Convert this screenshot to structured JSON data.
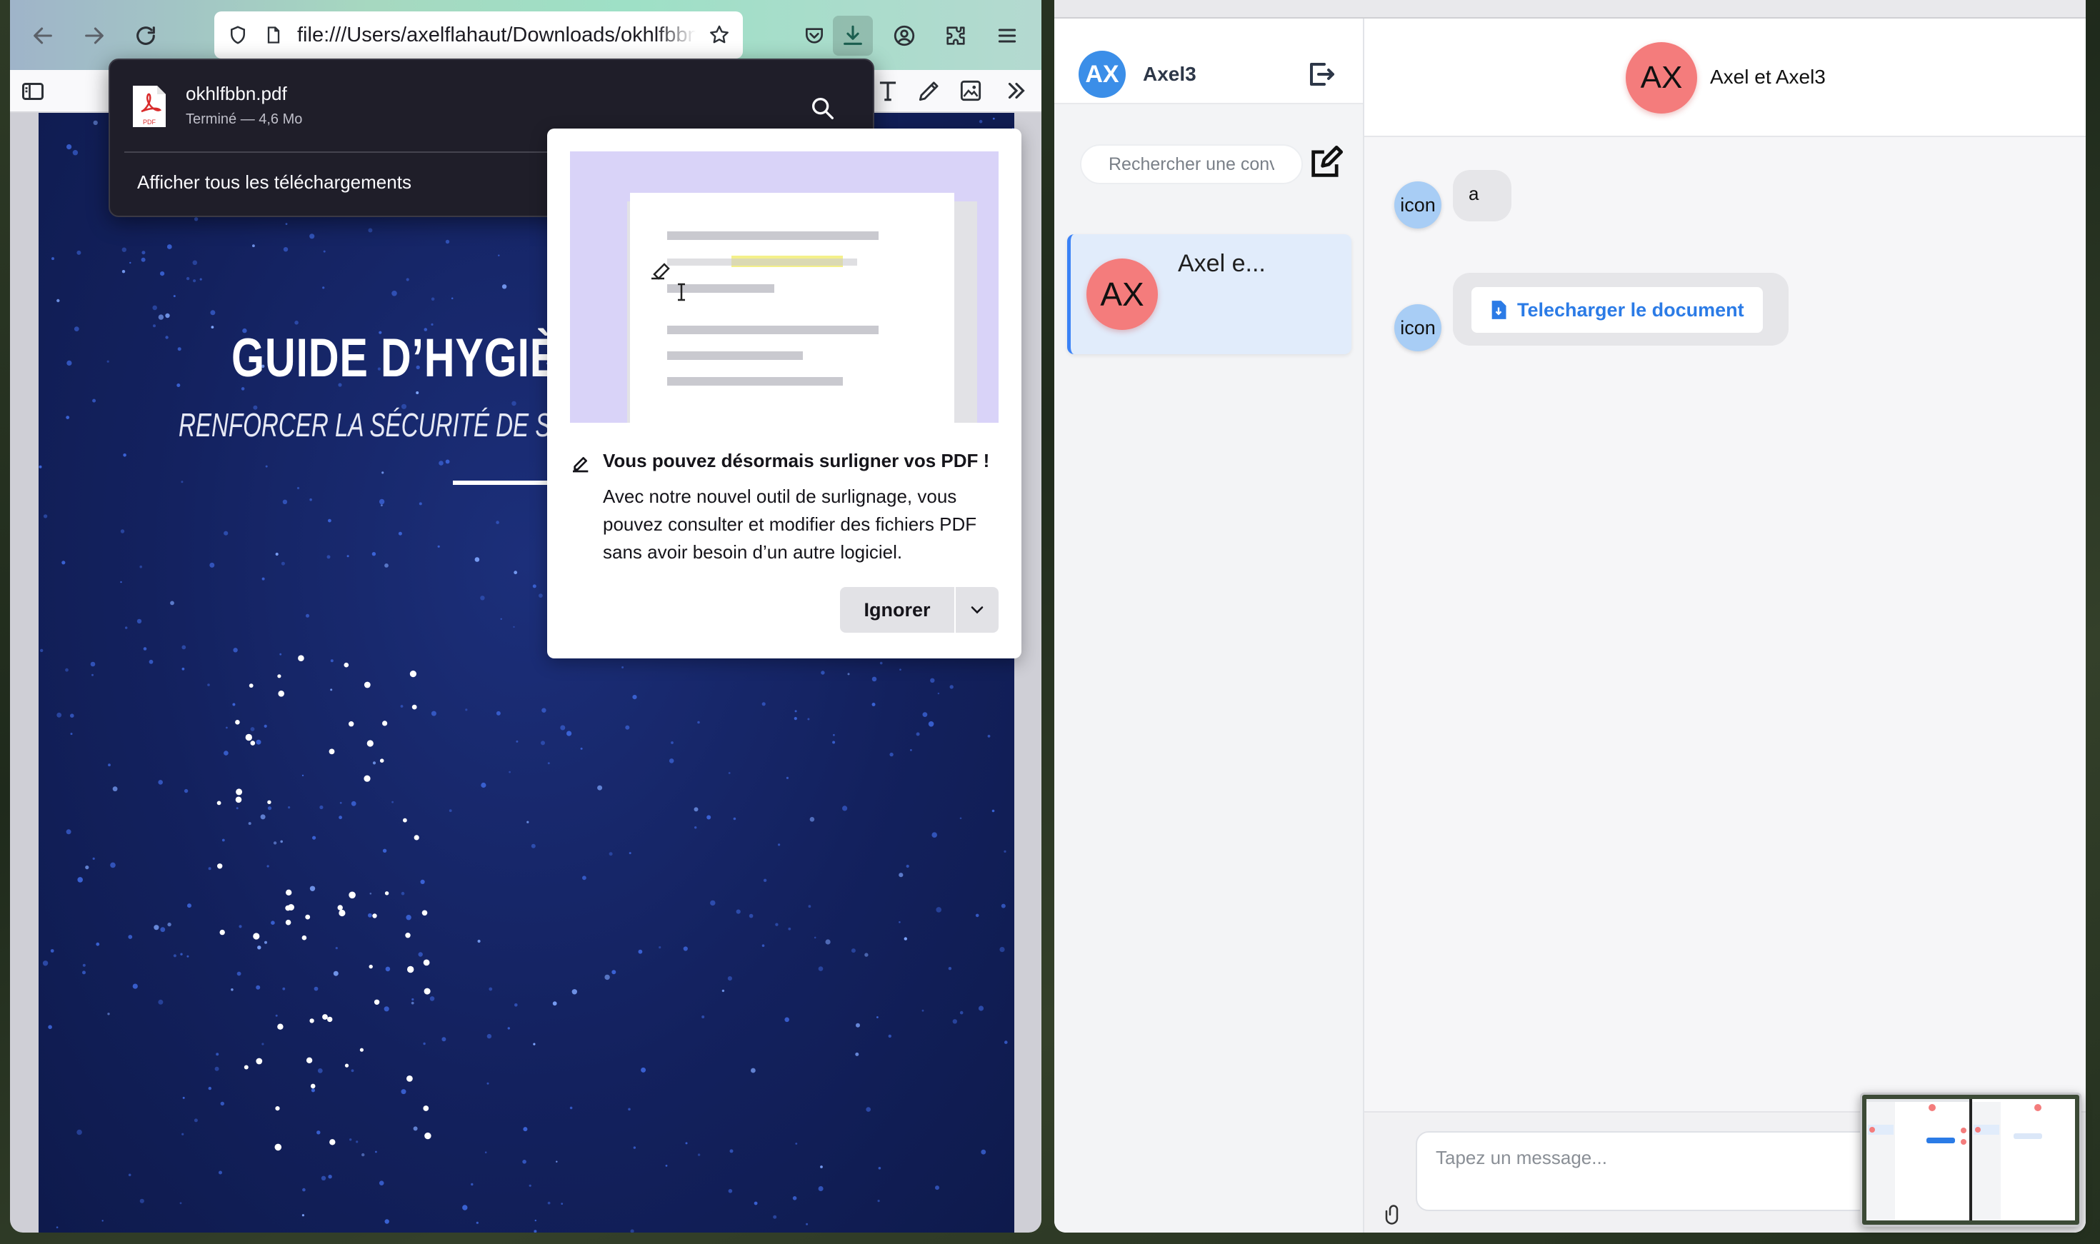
{
  "browser": {
    "url": "file:///Users/axelflahaut/Downloads/okhlfbbn.pdf",
    "downloads": {
      "file_name": "okhlfbbn.pdf",
      "file_status": "Terminé — 4,6 Mo",
      "show_all": "Afficher tous les téléchargements",
      "pdf_badge": "PDF"
    },
    "pdf": {
      "title": "GUIDE D’HYGIÈNE",
      "subtitle": "RENFORCER LA SÉCURITÉ DE SON SYSTÈ"
    },
    "callout": {
      "title": "Vous pouvez désormais surligner vos PDF !",
      "body": "Avec notre nouvel outil de surlignage, vous pouvez consulter et modifier des fichiers PDF sans avoir besoin d’un autre logiciel.",
      "ignore_label": "Ignorer"
    }
  },
  "chat": {
    "current_user": {
      "initials": "AX",
      "name": "Axel3"
    },
    "search_placeholder": "Rechercher une conversation",
    "conversations": [
      {
        "initials": "AX",
        "name": "Axel e..."
      }
    ],
    "header": {
      "initials": "AX",
      "title": "Axel et Axel3"
    },
    "messages": [
      {
        "sender_icon": "icon",
        "text": "a"
      },
      {
        "sender_icon": "icon",
        "document_label": "Telecharger le document"
      }
    ],
    "composer_placeholder": "Tapez un message..."
  },
  "colors": {
    "accent_blue": "#3b82f6",
    "avatar_red": "#f47c7c",
    "avatar_blue": "#3b8ee8",
    "pdf_background": "#13215e"
  }
}
